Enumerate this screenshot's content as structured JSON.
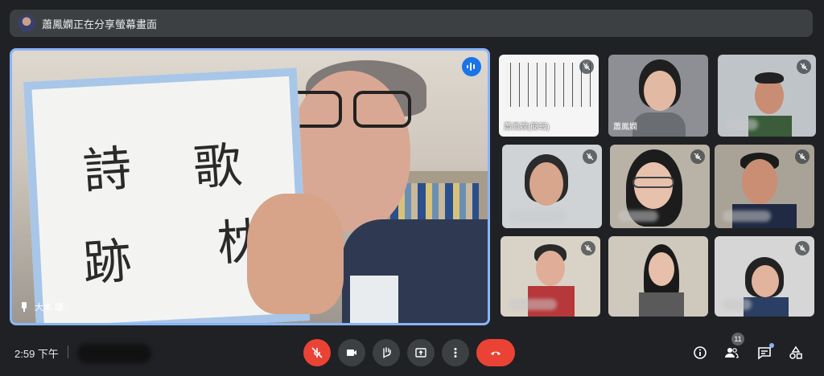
{
  "banner": {
    "text": "蕭鳳嫻正在分享螢幕畫面"
  },
  "main_tile": {
    "name": "大木 康.",
    "calligraphy": [
      "詩",
      "歌",
      "跡",
      "枕"
    ]
  },
  "thumbnails": [
    {
      "name": "蕭鳳嫻(簡報)",
      "muted": true
    },
    {
      "name": "蕭鳳嫻",
      "muted": false
    },
    {
      "name": "",
      "muted": true
    },
    {
      "name": "",
      "muted": true
    },
    {
      "name": "",
      "muted": true
    },
    {
      "name": "",
      "muted": true
    },
    {
      "name": "",
      "muted": false
    },
    {
      "name": "",
      "muted": false
    },
    {
      "name": "",
      "muted": true
    }
  ],
  "bottom_bar": {
    "time": "2:59 下午",
    "participant_count": "11"
  },
  "colors": {
    "accent": "#8ab4f8",
    "danger": "#ea4335",
    "surface": "#3c4043",
    "background": "#202124"
  }
}
